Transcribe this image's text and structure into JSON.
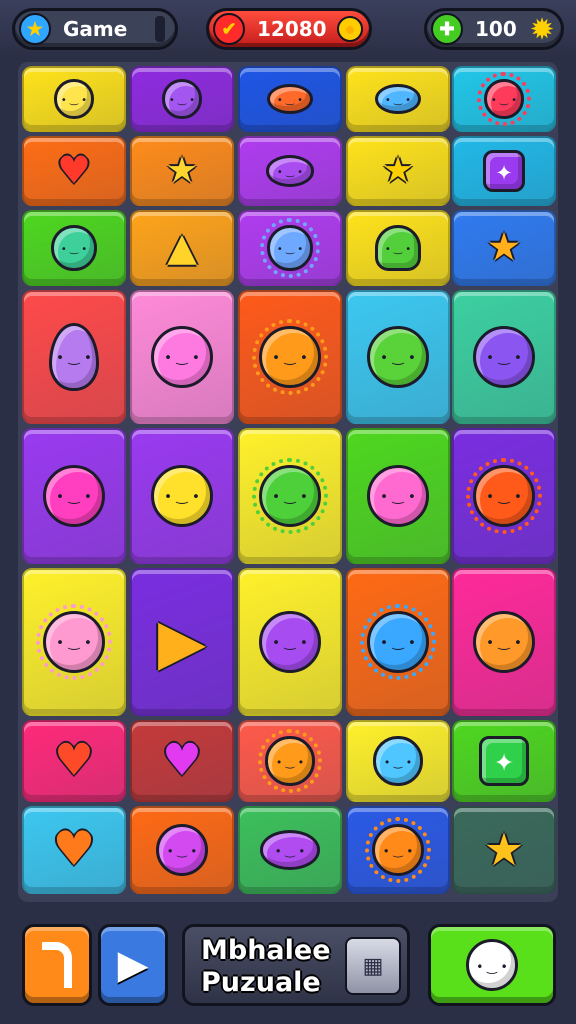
{
  "hud": {
    "mode_label": "Game",
    "score": "12080",
    "coins": "100"
  },
  "icons": {
    "mode": "star-badge-icon",
    "score_left": "heart-check-icon",
    "score_right": "gold-coin-icon",
    "coins_left": "green-gem-icon",
    "coins_right": "yellow-gear-icon"
  },
  "board": {
    "rows": [
      [
        {
          "bg": "#ffe31a",
          "kind": "cat",
          "color": "#ffe54d"
        },
        {
          "bg": "#8f2be0",
          "kind": "star-creature",
          "color": "#a356f0"
        },
        {
          "bg": "#1e56e6",
          "kind": "blob",
          "color": "#ff6a2a"
        },
        {
          "bg": "#ffe31a",
          "kind": "fish",
          "color": "#4fb6ff"
        },
        {
          "bg": "#21c7e8",
          "kind": "flower",
          "color": "#ff3b5c"
        }
      ],
      [
        {
          "bg": "#ff6d14",
          "kind": "heart",
          "color": "#ff3a2a"
        },
        {
          "bg": "#ff8c1a",
          "kind": "star",
          "color": "#ffd62e"
        },
        {
          "bg": "#b03cf0",
          "kind": "blob",
          "color": "#a94cf0"
        },
        {
          "bg": "#ffe31a",
          "kind": "star",
          "color": "#ffd000"
        },
        {
          "bg": "#21b9e8",
          "kind": "square",
          "color": "#9a3bf0"
        }
      ],
      [
        {
          "bg": "#4ed81f",
          "kind": "cat",
          "color": "#3ed09a"
        },
        {
          "bg": "#ffa41a",
          "kind": "cone",
          "color": "#ffd32a"
        },
        {
          "bg": "#b03cf0",
          "kind": "spiky",
          "color": "#6fa8ff"
        },
        {
          "bg": "#ffe31a",
          "kind": "ghost",
          "color": "#52cf3a"
        },
        {
          "bg": "#2f7bf0",
          "kind": "star",
          "color": "#ffb01a"
        }
      ],
      [
        {
          "bg": "#ff4a4a",
          "kind": "egg",
          "color": "#b77bf0"
        },
        {
          "bg": "#ff8ad8",
          "kind": "bunny",
          "color": "#ff7ae0"
        },
        {
          "bg": "#ff5a1a",
          "kind": "sun",
          "color": "#ff9a1a"
        },
        {
          "bg": "#3cc8f0",
          "kind": "bunny",
          "color": "#5ad23a"
        },
        {
          "bg": "#3cd0a0",
          "kind": "bunny",
          "color": "#8a55f0"
        }
      ],
      [
        {
          "bg": "#9a3af0",
          "kind": "cat",
          "color": "#ff3fc0"
        },
        {
          "bg": "#9a3af0",
          "kind": "bunny",
          "color": "#ffe02a"
        },
        {
          "bg": "#fff12a",
          "kind": "spiky",
          "color": "#4ed03a"
        },
        {
          "bg": "#4ed81f",
          "kind": "bunny",
          "color": "#ff6ad0"
        },
        {
          "bg": "#7a2ee0",
          "kind": "sun",
          "color": "#ff5a1a"
        }
      ],
      [
        {
          "bg": "#fff12a",
          "kind": "flower",
          "color": "#ff9ad0"
        },
        {
          "bg": "#7a2ee0",
          "kind": "play",
          "color": "#ffb01a"
        },
        {
          "bg": "#fff12a",
          "kind": "bunny",
          "color": "#a64cf0"
        },
        {
          "bg": "#ff6a14",
          "kind": "spiky",
          "color": "#3aa8ff"
        },
        {
          "bg": "#ff2a9a",
          "kind": "fox",
          "color": "#ff9a2a"
        }
      ],
      [
        {
          "bg": "#ff2a7a",
          "kind": "heart",
          "color": "#ff4a2a"
        },
        {
          "bg": "#c43a3a",
          "kind": "heart",
          "color": "#e23af0"
        },
        {
          "bg": "#ff5a4a",
          "kind": "sun",
          "color": "#ff9a1a"
        },
        {
          "bg": "#fff12a",
          "kind": "cat",
          "color": "#4fc6ff"
        },
        {
          "bg": "#4ed81f",
          "kind": "square",
          "color": "#2fd04a"
        }
      ],
      [
        {
          "bg": "#3cc8f0",
          "kind": "heart",
          "color": "#ff7a1a"
        },
        {
          "bg": "#ff6a14",
          "kind": "cat",
          "color": "#d24af0"
        },
        {
          "bg": "#3cc05a",
          "kind": "blob",
          "color": "#b04cf0"
        },
        {
          "bg": "#2a5ae6",
          "kind": "sun",
          "color": "#ff8a1a"
        },
        {
          "bg": "#3a6a5a",
          "kind": "star",
          "color": "#ffc21a"
        }
      ]
    ]
  },
  "bottom": {
    "title_line1": "Mbhalee",
    "title_line2": "Puzuale",
    "left_button_icon": "orange-hook-icon",
    "play_button_icon": "play-icon",
    "mini_button_icon": "grid-menu-icon",
    "right_button_icon": "spiky-creature-icon",
    "colors": {
      "left": "#ff8a1a",
      "play": "#3a7ae0",
      "right": "#5ae01a"
    }
  }
}
